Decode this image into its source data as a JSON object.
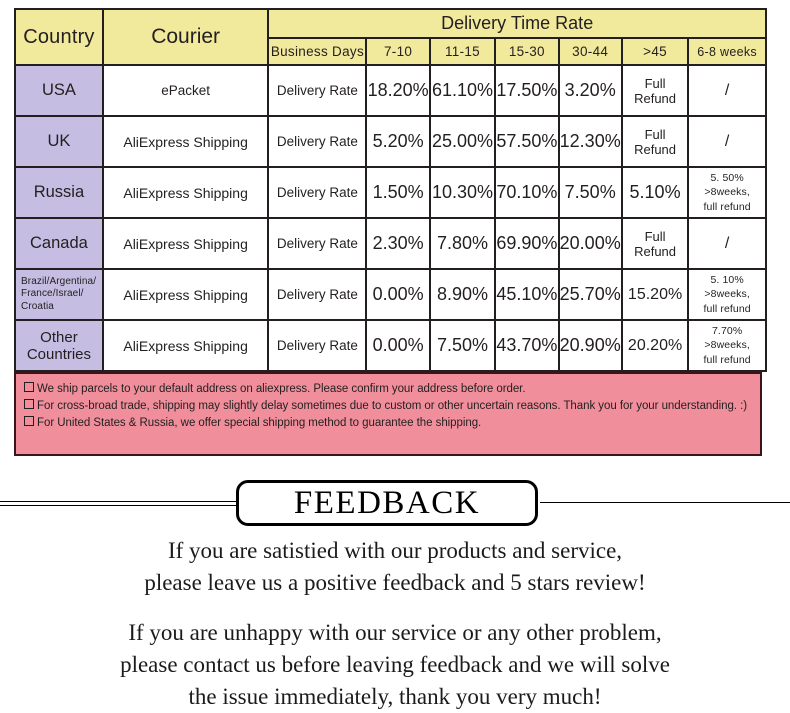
{
  "shipping_table": {
    "headers": {
      "country": "Country",
      "courier": "Courier",
      "delivery_time_rate": "Delivery Time Rate",
      "business_days": "Business Days",
      "ranges": [
        "7-10",
        "11-15",
        "15-30",
        "30-44",
        ">45",
        "6-8 weeks"
      ]
    },
    "rate_label": "Delivery Rate",
    "rows": [
      {
        "country": "USA",
        "courier": "ePacket",
        "rate_label": "Delivery Rate",
        "values": [
          "18.20%",
          "61.10%",
          "17.50%",
          "3.20%",
          "Full Refund",
          "/"
        ]
      },
      {
        "country": "UK",
        "courier": "AliExpress Shipping",
        "rate_label": "Delivery Rate",
        "values": [
          "5.20%",
          "25.00%",
          "57.50%",
          "12.30%",
          "Full Refund",
          "/"
        ]
      },
      {
        "country": "Russia",
        "courier": "AliExpress Shipping",
        "rate_label": "Delivery Rate",
        "values": [
          "1.50%",
          "10.30%",
          "70.10%",
          "7.50%",
          "5.10%",
          "5. 50%\n>8weeks,\nfull refund"
        ]
      },
      {
        "country": "Canada",
        "courier": "AliExpress Shipping",
        "rate_label": "Delivery Rate",
        "values": [
          "2.30%",
          "7.80%",
          "69.90%",
          "20.00%",
          "Full Refund",
          "/"
        ]
      },
      {
        "country": "Brazil/Argentina/\nFrance/Israel/\nCroatia",
        "courier": "AliExpress Shipping",
        "rate_label": "Delivery Rate",
        "values": [
          "0.00%",
          "8.90%",
          "45.10%",
          "25.70%",
          "15.20%",
          "5. 10%\n>8weeks,\nfull refund"
        ]
      },
      {
        "country": "Other Countries",
        "courier": "AliExpress Shipping",
        "rate_label": "Delivery Rate",
        "values": [
          "0.00%",
          "7.50%",
          "43.70%",
          "20.90%",
          "20.20%",
          "7.70%\n>8weeks,\nfull refund"
        ]
      }
    ]
  },
  "notes": {
    "lines": [
      "We ship parcels to your default address on aliexpress. Please confirm your address before order.",
      "For cross-broad trade, shipping may slightly delay sometimes due to custom or other uncertain reasons. Thank you for your understanding. :)",
      "For United States & Russia, we offer special shipping method to guarantee the shipping."
    ]
  },
  "feedback": {
    "badge": "FEEDBACK",
    "paragraph1": [
      "If you are satistied with our products and service,",
      "please leave us a positive feedback and 5 stars review!"
    ],
    "paragraph2": [
      "If you are unhappy with our service or any other problem,",
      "please contact us before leaving feedback and we will solve",
      "the issue immediately, thank you very much!"
    ]
  },
  "colors": {
    "header_yellow": "#f1e99b",
    "country_purple": "#c5bde2",
    "notes_pink": "#f08f9b",
    "border_dark": "#231f20"
  }
}
